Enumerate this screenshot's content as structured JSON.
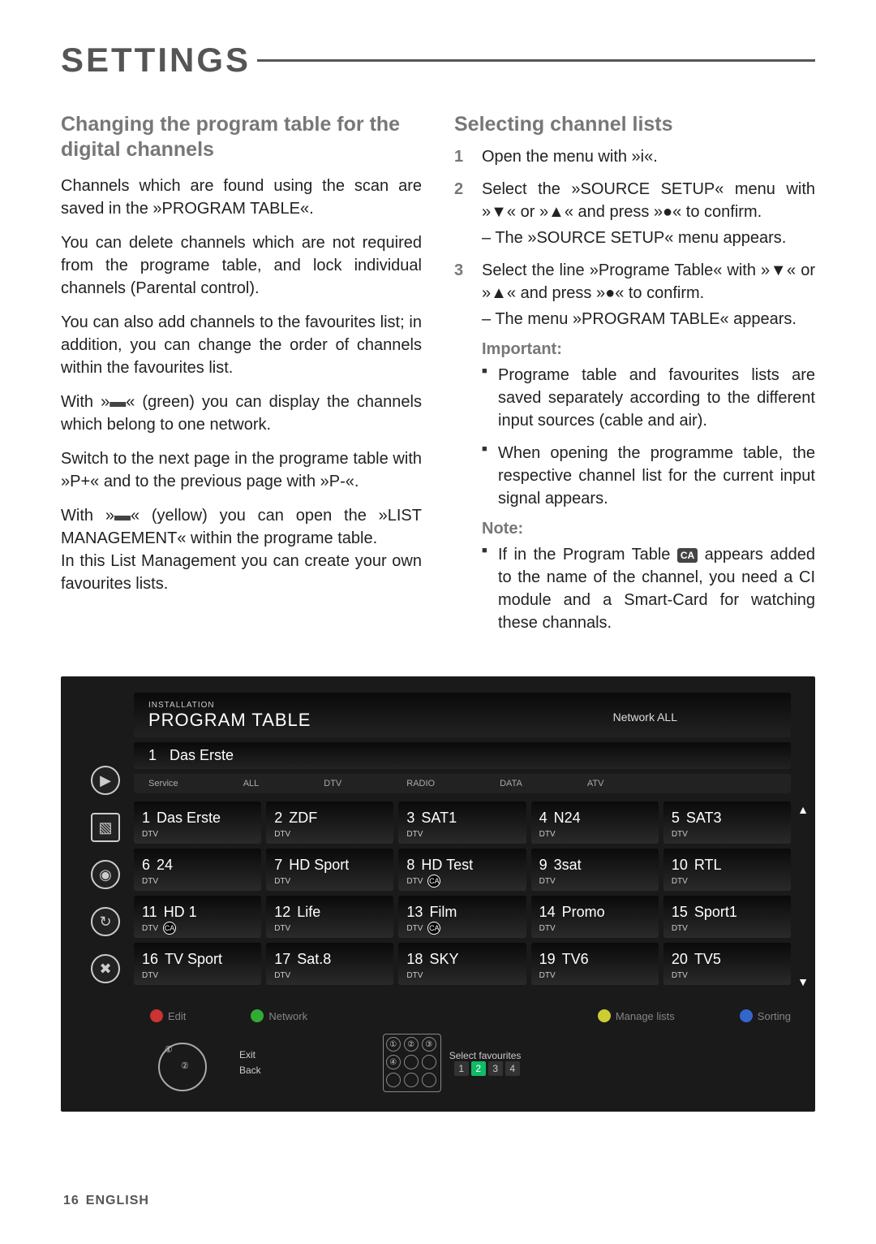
{
  "page_title": "SETTINGS",
  "left": {
    "h2": "Changing the program table for the digital channels",
    "p1": "Channels which are found using the scan are saved in the »PROGRAM TABLE«.",
    "p2": "You can delete channels which are not required from the programe table, and lock individual channels (Parental control).",
    "p3": "You can also add channels to the favourites list; in addition, you can change the order of channels within the favourites list.",
    "p4a": "With »",
    "p4b": "« (green) you can display the channels which belong to one network.",
    "p5": "Switch to the next page in the programe table with »P+« and to the previous page with »P-«.",
    "p6a": "With »",
    "p6b": "« (yellow) you can open the »LIST MANAGEMENT« within the programe table.",
    "p7": "In this List Management you can create your own favourites lists."
  },
  "right": {
    "h3": "Selecting channel lists",
    "steps": [
      {
        "num": "1",
        "text": "Open the menu with »i«."
      },
      {
        "num": "2",
        "text": "Select the »SOURCE SETUP« menu with »▼« or »▲« and press »●« to confirm.",
        "sub": "– The »SOURCE SETUP« menu appears."
      },
      {
        "num": "3",
        "text": "Select the line »Programe Table« with »▼« or »▲« and press »●« to confirm.",
        "sub": "– The menu »PROGRAM TABLE« appears."
      }
    ],
    "important_label": "Important:",
    "bullets_imp": [
      "Programe table and favourites lists are saved separately according to the different input sources (cable and air).",
      "When opening the programme table, the respective channel list for the current input signal appears."
    ],
    "note_label": "Note:",
    "note_pre": "If in the Program Table ",
    "note_post": " appears added to the name of the channel, you need a CI module and a Smart-Card for watching these channals.",
    "ca_label": "CA"
  },
  "tv": {
    "installation": "INSTALLATION",
    "title": "PROGRAM TABLE",
    "network": "Network ALL",
    "current_num": "1",
    "current_name": "Das Erste",
    "tabs": [
      "Service",
      "ALL",
      "DTV",
      "RADIO",
      "DATA",
      "ATV"
    ],
    "channels": [
      {
        "n": "1",
        "name": "Das Erste",
        "ca": false
      },
      {
        "n": "2",
        "name": "ZDF",
        "ca": false
      },
      {
        "n": "3",
        "name": "SAT1",
        "ca": false
      },
      {
        "n": "4",
        "name": "N24",
        "ca": false
      },
      {
        "n": "5",
        "name": "SAT3",
        "ca": false
      },
      {
        "n": "6",
        "name": "24",
        "ca": false
      },
      {
        "n": "7",
        "name": "HD Sport",
        "ca": false
      },
      {
        "n": "8",
        "name": "HD Test",
        "ca": true
      },
      {
        "n": "9",
        "name": "3sat",
        "ca": false
      },
      {
        "n": "10",
        "name": "RTL",
        "ca": false
      },
      {
        "n": "11",
        "name": "HD 1",
        "ca": true
      },
      {
        "n": "12",
        "name": "Life",
        "ca": false
      },
      {
        "n": "13",
        "name": "Film",
        "ca": true
      },
      {
        "n": "14",
        "name": "Promo",
        "ca": false
      },
      {
        "n": "15",
        "name": "Sport1",
        "ca": false
      },
      {
        "n": "16",
        "name": "TV Sport",
        "ca": false
      },
      {
        "n": "17",
        "name": "Sat.8",
        "ca": false
      },
      {
        "n": "18",
        "name": "SKY",
        "ca": false
      },
      {
        "n": "19",
        "name": "TV6",
        "ca": false
      },
      {
        "n": "20",
        "name": "TV5",
        "ca": false
      }
    ],
    "dtv_label": "DTV",
    "ca_small": "CA",
    "footer": {
      "edit": "Edit",
      "network": "Network",
      "manage": "Manage lists",
      "sorting": "Sorting",
      "exit": "Exit",
      "back": "Back",
      "selectfav": "Select favourites",
      "favnums": [
        "1",
        "2",
        "3",
        "4"
      ],
      "circle_nums": [
        "①",
        "②",
        "③",
        "④"
      ]
    }
  },
  "footer": {
    "page": "16",
    "lang": "ENGLISH"
  }
}
